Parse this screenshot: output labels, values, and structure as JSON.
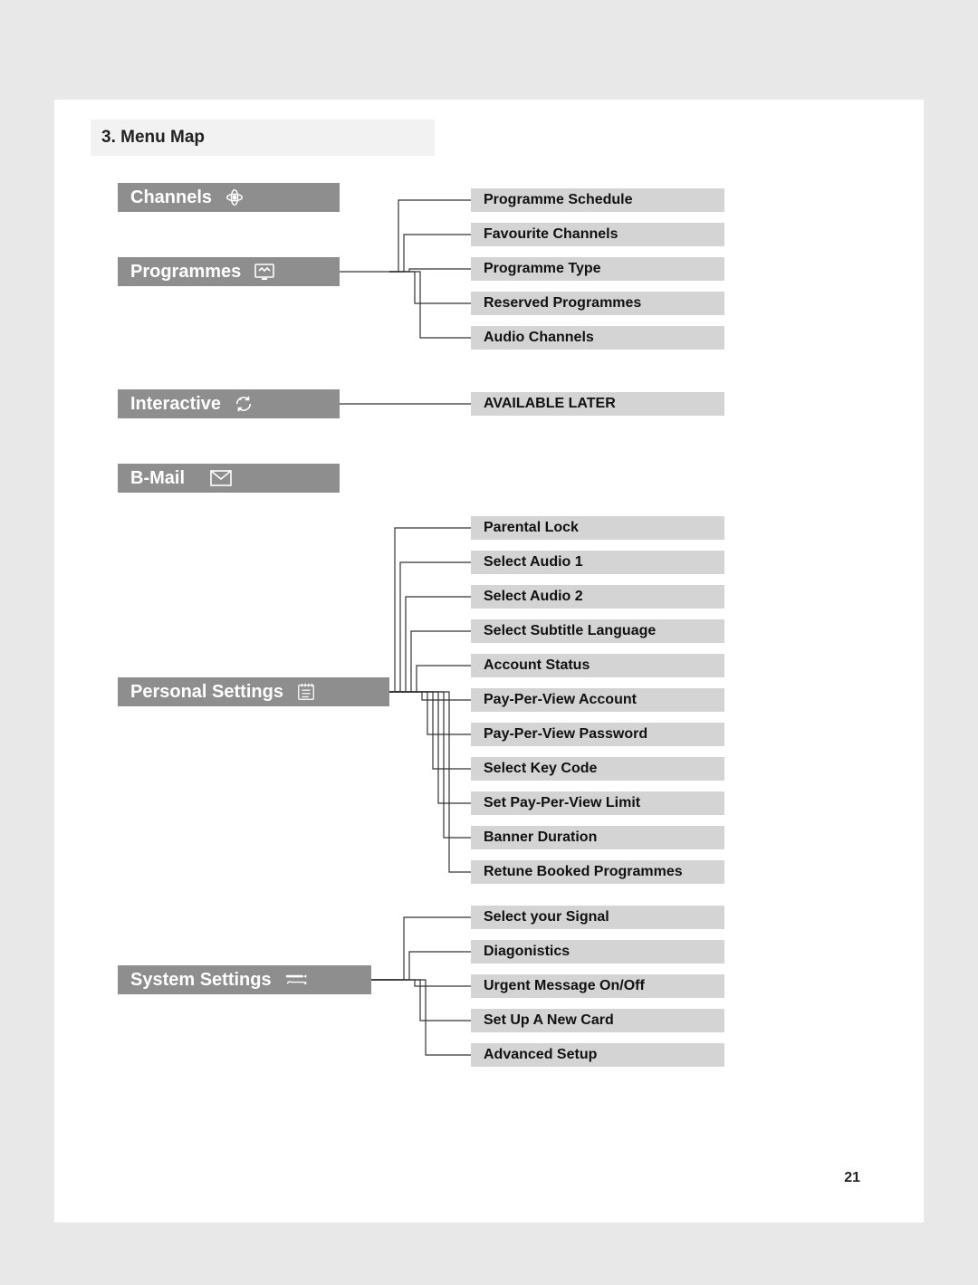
{
  "section": {
    "title": "3. Menu Map"
  },
  "main": {
    "channels": {
      "label": "Channels"
    },
    "programmes": {
      "label": "Programmes"
    },
    "interactive": {
      "label": "Interactive"
    },
    "bmail": {
      "label": "B-Mail"
    },
    "personal": {
      "label": "Personal Settings"
    },
    "system": {
      "label": "System Settings"
    }
  },
  "programmes_sub": [
    "Programme Schedule",
    "Favourite Channels",
    "Programme Type",
    "Reserved Programmes",
    "Audio Channels"
  ],
  "interactive_sub": [
    "AVAILABLE LATER"
  ],
  "personal_sub": [
    "Parental Lock",
    "Select Audio 1",
    "Select Audio 2",
    "Select Subtitle Language",
    "Account Status",
    "Pay-Per-View Account",
    "Pay-Per-View Password",
    "Select Key Code",
    "Set Pay-Per-View Limit",
    "Banner Duration",
    "Retune Booked Programmes"
  ],
  "system_sub": [
    "Select your Signal",
    "Diagonistics",
    "Urgent Message On/Off",
    "Set Up A New Card",
    "Advanced Setup"
  ],
  "page_number": "21"
}
